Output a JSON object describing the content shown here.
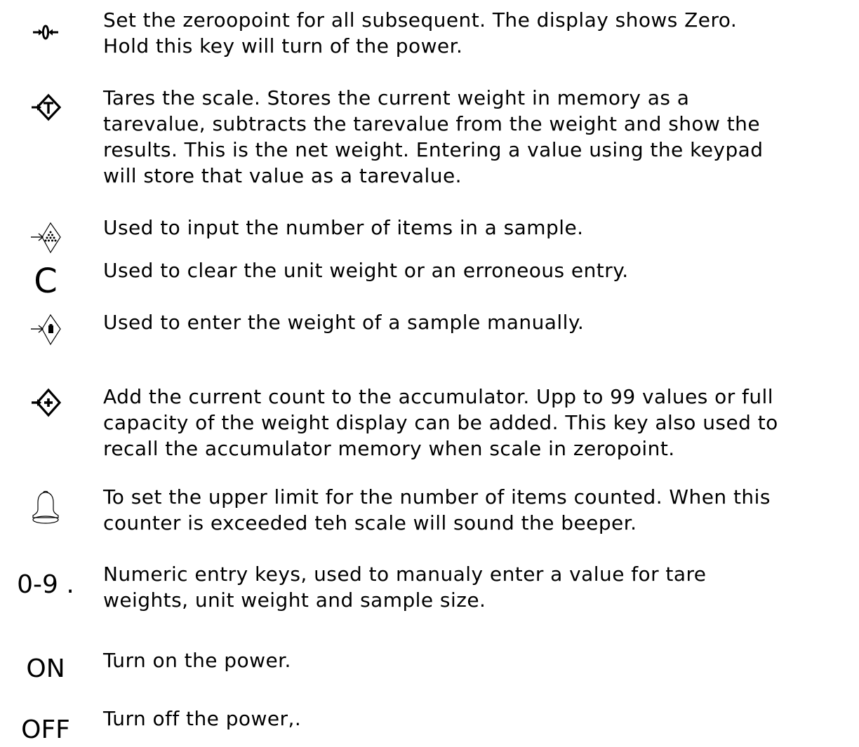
{
  "keys": [
    {
      "id": "zero",
      "icon": "zero-key-icon",
      "label": "",
      "description": "Set the zeroopoint for all subsequent. The display shows Zero.\nHold this key will turn of the power."
    },
    {
      "id": "tare",
      "icon": "tare-key-icon",
      "label": "",
      "description": "Tares the scale. Stores the current weight in memory as a\ntarevalue, subtracts the tarevalue from the weight and show the\nresults. This is the net weight. Entering a value using the keypad\nwill store that value as a tarevalue."
    },
    {
      "id": "sample",
      "icon": "sample-count-key-icon",
      "label": "",
      "description": "Used to input the number of items in a sample."
    },
    {
      "id": "clear",
      "icon": "",
      "label": "C",
      "description": "Used to clear the unit weight or an erroneous entry."
    },
    {
      "id": "unit-weight",
      "icon": "sample-weight-key-icon",
      "label": "",
      "description": "Used to enter the weight of a sample manually."
    },
    {
      "id": "accumulate",
      "icon": "accumulate-key-icon",
      "label": "",
      "description": "Add the current count to the accumulator. Upp to 99 values or full\ncapacity of the weight display can be added. This key also used to\nrecall the accumulator memory when scale in zeropoint."
    },
    {
      "id": "limit",
      "icon": "bell-icon",
      "label": "",
      "description": "To set the upper limit for the number of items counted. When this\ncounter is exceeded teh scale will sound the beeper."
    },
    {
      "id": "numeric",
      "icon": "",
      "label": "0-9 .",
      "description": "Numeric entry keys, used to manualy enter a value for tare\nweights, unit weight and sample size."
    },
    {
      "id": "on",
      "icon": "",
      "label": "ON",
      "description": "Turn on the power."
    },
    {
      "id": "off",
      "icon": "",
      "label": "OFF",
      "description": "Turn off the power,."
    }
  ]
}
